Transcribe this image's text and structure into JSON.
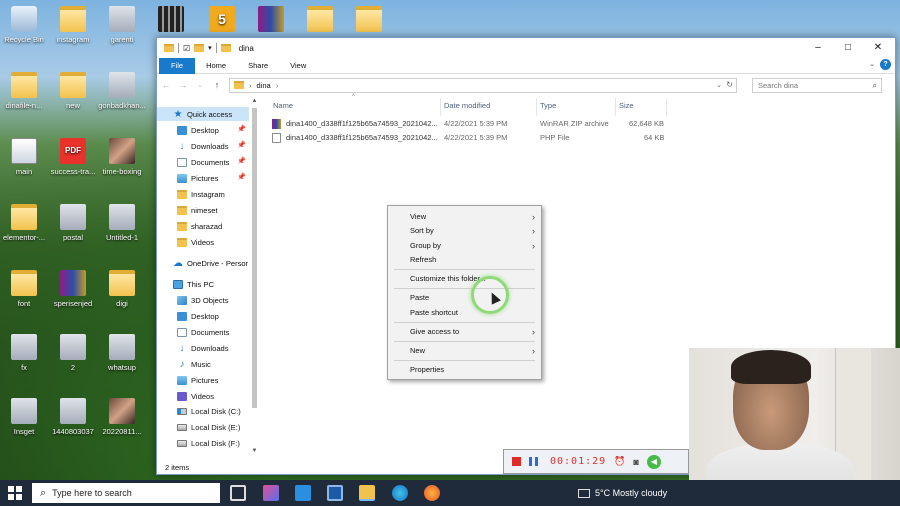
{
  "desktop": {
    "icons": [
      {
        "label": "Recycle Bin",
        "icon": "recycle-bin-icon"
      },
      {
        "label": "instagram",
        "icon": "folder-icon"
      },
      {
        "label": "garenti",
        "icon": "app-icon"
      },
      {
        "label": "",
        "icon": "video-icon"
      },
      {
        "label": "",
        "icon": "app-icon"
      },
      {
        "label": "",
        "icon": "winrar-icon"
      },
      {
        "label": "",
        "icon": "folder-icon"
      },
      {
        "label": "",
        "icon": "folder-icon"
      },
      {
        "label": "dinafile-n...",
        "icon": "folder-icon"
      },
      {
        "label": "new",
        "icon": "folder-icon"
      },
      {
        "label": "gonbadkhan...",
        "icon": "app-icon"
      },
      {
        "label": "main",
        "icon": "app-icon"
      },
      {
        "label": "success-tra...",
        "icon": "pdf-icon"
      },
      {
        "label": "time-boxing",
        "icon": "photo-icon"
      },
      {
        "label": "elementor-...",
        "icon": "folder-icon"
      },
      {
        "label": "postal",
        "icon": "app-icon"
      },
      {
        "label": "Untitled-1",
        "icon": "app-icon"
      },
      {
        "label": "font",
        "icon": "folder-icon"
      },
      {
        "label": "sperisenjed",
        "icon": "winrar-icon"
      },
      {
        "label": "digi",
        "icon": "folder-icon"
      },
      {
        "label": "fx",
        "icon": "app-icon"
      },
      {
        "label": "2",
        "icon": "app-icon"
      },
      {
        "label": "whatsup",
        "icon": "app-icon"
      },
      {
        "label": "Insget",
        "icon": "app-icon"
      },
      {
        "label": "1440803037",
        "icon": "app-icon"
      },
      {
        "label": "20220811...",
        "icon": "photo-icon"
      }
    ]
  },
  "window": {
    "title": "dina",
    "controls": {
      "minimize": "–",
      "maximize": "□",
      "close": "✕"
    },
    "ribbon_tabs": [
      "File",
      "Home",
      "Share",
      "View"
    ],
    "help": "?",
    "address": {
      "path": "dina",
      "separator": "›"
    },
    "search": {
      "placeholder": "Search dina"
    },
    "nav": {
      "quick_access": "Quick access",
      "quick_items": [
        "Desktop",
        "Downloads",
        "Documents",
        "Pictures",
        "Instagram",
        "nimeset",
        "sharazad",
        "Videos"
      ],
      "onedrive": "OneDrive - Persor",
      "this_pc": "This PC",
      "pc_items": [
        "3D Objects",
        "Desktop",
        "Documents",
        "Downloads",
        "Music",
        "Pictures",
        "Videos",
        "Local Disk (C:)",
        "Local Disk (E:)",
        "Local Disk (F:)"
      ]
    },
    "columns": {
      "name": "Name",
      "date": "Date modified",
      "type": "Type",
      "size": "Size"
    },
    "files": [
      {
        "name": "dina1400_d338ff1f125b65a74593_2021042...",
        "date": "4/22/2021 5:39 PM",
        "type": "WinRAR ZIP archive",
        "size": "62,648 KB",
        "icon": "zip-icon"
      },
      {
        "name": "dina1400_d338ff1f125b65a74593_2021042...",
        "date": "4/22/2021 5:39 PM",
        "type": "PHP File",
        "size": "64 KB",
        "icon": "php-file-icon"
      }
    ],
    "status": "2 items"
  },
  "context_menu": {
    "items": [
      {
        "label": "View",
        "submenu": true
      },
      {
        "label": "Sort by",
        "submenu": true
      },
      {
        "label": "Group by",
        "submenu": true
      },
      {
        "label": "Refresh",
        "submenu": false
      },
      {
        "label": "Customize this folder...",
        "submenu": false
      },
      {
        "label": "Paste",
        "submenu": false
      },
      {
        "label": "Paste shortcut",
        "submenu": false
      },
      {
        "label": "Give access to",
        "submenu": true
      },
      {
        "label": "New",
        "submenu": true
      },
      {
        "label": "Properties",
        "submenu": false
      }
    ]
  },
  "recorder": {
    "time": "00:01:29"
  },
  "taskbar": {
    "search_placeholder": "Type here to search",
    "weather": "5°C  Mostly cloudy"
  },
  "colors": {
    "accent": "#1979ca",
    "selection": "#cce4f7",
    "record_red": "#e02a2a"
  }
}
